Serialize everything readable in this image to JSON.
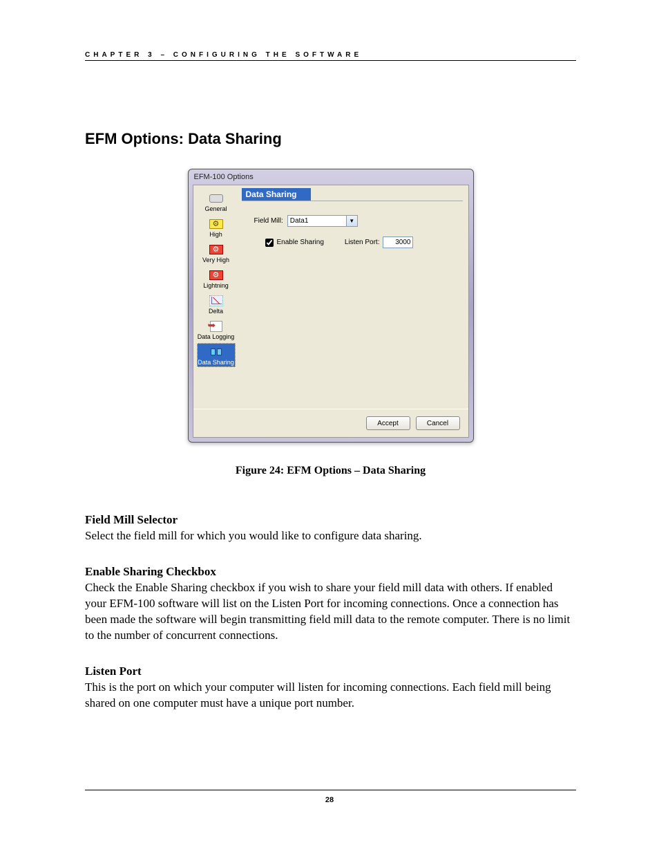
{
  "chapter_header": "CHAPTER 3 – CONFIGURING THE SOFTWARE",
  "section_title": "EFM Options: Data Sharing",
  "dialog": {
    "window_title": "EFM-100 Options",
    "sidebar": {
      "items": [
        {
          "label": "General"
        },
        {
          "label": "High"
        },
        {
          "label": "Very High"
        },
        {
          "label": "Lightning"
        },
        {
          "label": "Delta"
        },
        {
          "label": "Data Logging"
        },
        {
          "label": "Data Sharing"
        }
      ]
    },
    "content": {
      "title": "Data Sharing",
      "field_mill_label": "Field Mill:",
      "field_mill_value": "Data1",
      "enable_sharing_label": "Enable Sharing",
      "enable_sharing_checked": true,
      "listen_port_label": "Listen Port:",
      "listen_port_value": "3000"
    },
    "buttons": {
      "accept": "Accept",
      "cancel": "Cancel"
    }
  },
  "caption": "Figure 24:  EFM Options – Data Sharing",
  "sections": [
    {
      "title": "Field Mill Selector",
      "body": "Select the field mill for which you would like to configure data sharing."
    },
    {
      "title": "Enable Sharing Checkbox",
      "body": "Check the Enable Sharing checkbox if you wish to share your field mill data with others.  If enabled your EFM-100 software will list on the Listen Port for incoming connections.  Once a connection has been made the software will begin transmitting field mill data to the remote computer.  There is no limit to the number of concurrent connections."
    },
    {
      "title": "Listen Port",
      "body": "This is the port on which your computer will listen for incoming connections.  Each field mill being shared on one computer must have a unique port number."
    }
  ],
  "page_number": "28"
}
